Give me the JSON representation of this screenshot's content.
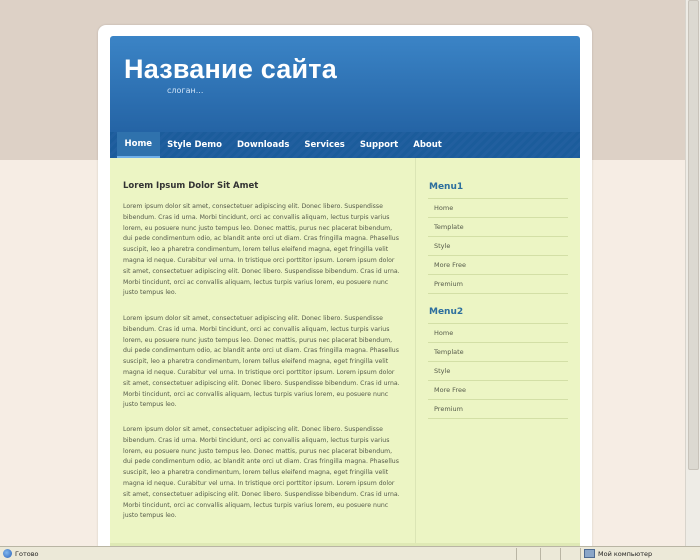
{
  "site": {
    "title": "Название сайта",
    "slogan": "слоган..."
  },
  "nav": {
    "items": [
      {
        "label": "Home",
        "active": true
      },
      {
        "label": "Style Demo"
      },
      {
        "label": "Downloads"
      },
      {
        "label": "Services"
      },
      {
        "label": "Support"
      },
      {
        "label": "About"
      }
    ]
  },
  "main": {
    "post_title": "Lorem Ipsum Dolor Sit Amet",
    "paragraphs": [
      "Lorem ipsum dolor sit amet, consectetuer adipiscing elit. Donec libero. Suspendisse bibendum. Cras id urna. Morbi tincidunt, orci ac convallis aliquam, lectus turpis varius lorem, eu posuere nunc justo tempus leo. Donec mattis, purus nec placerat bibendum, dui pede condimentum odio, ac blandit ante orci ut diam. Cras fringilla magna. Phasellus suscipit, leo a pharetra condimentum, lorem tellus eleifend magna, eget fringilla velit magna id neque. Curabitur vel urna. In tristique orci porttitor ipsum. Lorem ipsum dolor sit amet, consectetuer adipiscing elit. Donec libero. Suspendisse bibendum. Cras id urna. Morbi tincidunt, orci ac convallis aliquam, lectus turpis varius lorem, eu posuere nunc justo tempus leo.",
      "Lorem ipsum dolor sit amet, consectetuer adipiscing elit. Donec libero. Suspendisse bibendum. Cras id urna. Morbi tincidunt, orci ac convallis aliquam, lectus turpis varius lorem, eu posuere nunc justo tempus leo. Donec mattis, purus nec placerat bibendum, dui pede condimentum odio, ac blandit ante orci ut diam. Cras fringilla magna. Phasellus suscipit, leo a pharetra condimentum, lorem tellus eleifend magna, eget fringilla velit magna id neque. Curabitur vel urna. In tristique orci porttitor ipsum. Lorem ipsum dolor sit amet, consectetuer adipiscing elit. Donec libero. Suspendisse bibendum. Cras id urna. Morbi tincidunt, orci ac convallis aliquam, lectus turpis varius lorem, eu posuere nunc justo tempus leo.",
      "Lorem ipsum dolor sit amet, consectetuer adipiscing elit. Donec libero. Suspendisse bibendum. Cras id urna. Morbi tincidunt, orci ac convallis aliquam, lectus turpis varius lorem, eu posuere nunc justo tempus leo. Donec mattis, purus nec placerat bibendum, dui pede condimentum odio, ac blandit ante orci ut diam. Cras fringilla magna. Phasellus suscipit, leo a pharetra condimentum, lorem tellus eleifend magna, eget fringilla velit magna id neque. Curabitur vel urna. In tristique orci porttitor ipsum. Lorem ipsum dolor sit amet, consectetuer adipiscing elit. Donec libero. Suspendisse bibendum. Cras id urna. Morbi tincidunt, orci ac convallis aliquam, lectus turpis varius lorem, eu posuere nunc justo tempus leo."
    ]
  },
  "sidebar": {
    "menu1": {
      "title": "Menu1",
      "items": [
        "Home",
        "Template",
        "Style",
        "More Free",
        "Premium"
      ]
    },
    "menu2": {
      "title": "Menu2",
      "items": [
        "Home",
        "Template",
        "Style",
        "More Free",
        "Premium"
      ]
    }
  },
  "statusbar": {
    "left_text": "Готово",
    "right_text": "Мой компьютер"
  },
  "colors": {
    "header_blue": "#2a6fb0",
    "content_green": "#ecf5c4",
    "menu_title": "#2d6f9e",
    "page_bg": "#f6ede4"
  }
}
